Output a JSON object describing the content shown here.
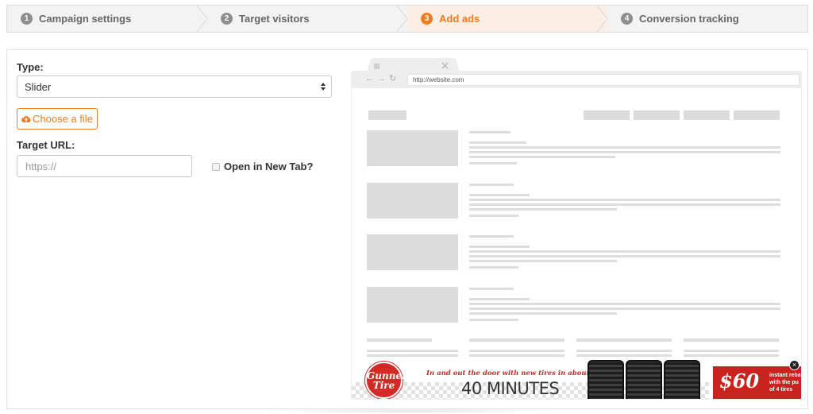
{
  "steps": [
    {
      "number": "1",
      "label": "Campaign settings",
      "active": false
    },
    {
      "number": "2",
      "label": "Target visitors",
      "active": false
    },
    {
      "number": "3",
      "label": "Add ads",
      "active": true
    },
    {
      "number": "4",
      "label": "Conversion tracking",
      "active": false
    }
  ],
  "form": {
    "type_label": "Type:",
    "type_value": "Slider",
    "choose_file_label": "Choose a file",
    "target_url_label": "Target URL:",
    "target_url_placeholder": "https://",
    "new_tab_label": "Open in New Tab?"
  },
  "preview": {
    "address": "http://website.com",
    "ad": {
      "brand_line1": "Gunner",
      "brand_line2": "Tire",
      "tagline": "In and out the door with new tires in about",
      "headline": "40 MINUTES",
      "price": "$60",
      "rebate_line1": "instant reba",
      "rebate_line2": "with the pu",
      "rebate_line3": "of 4 tires",
      "close": "×"
    }
  },
  "colors": {
    "accent": "#f47c20",
    "active_step_bg": "#fbeee4",
    "ad_red": "#c8231f"
  }
}
